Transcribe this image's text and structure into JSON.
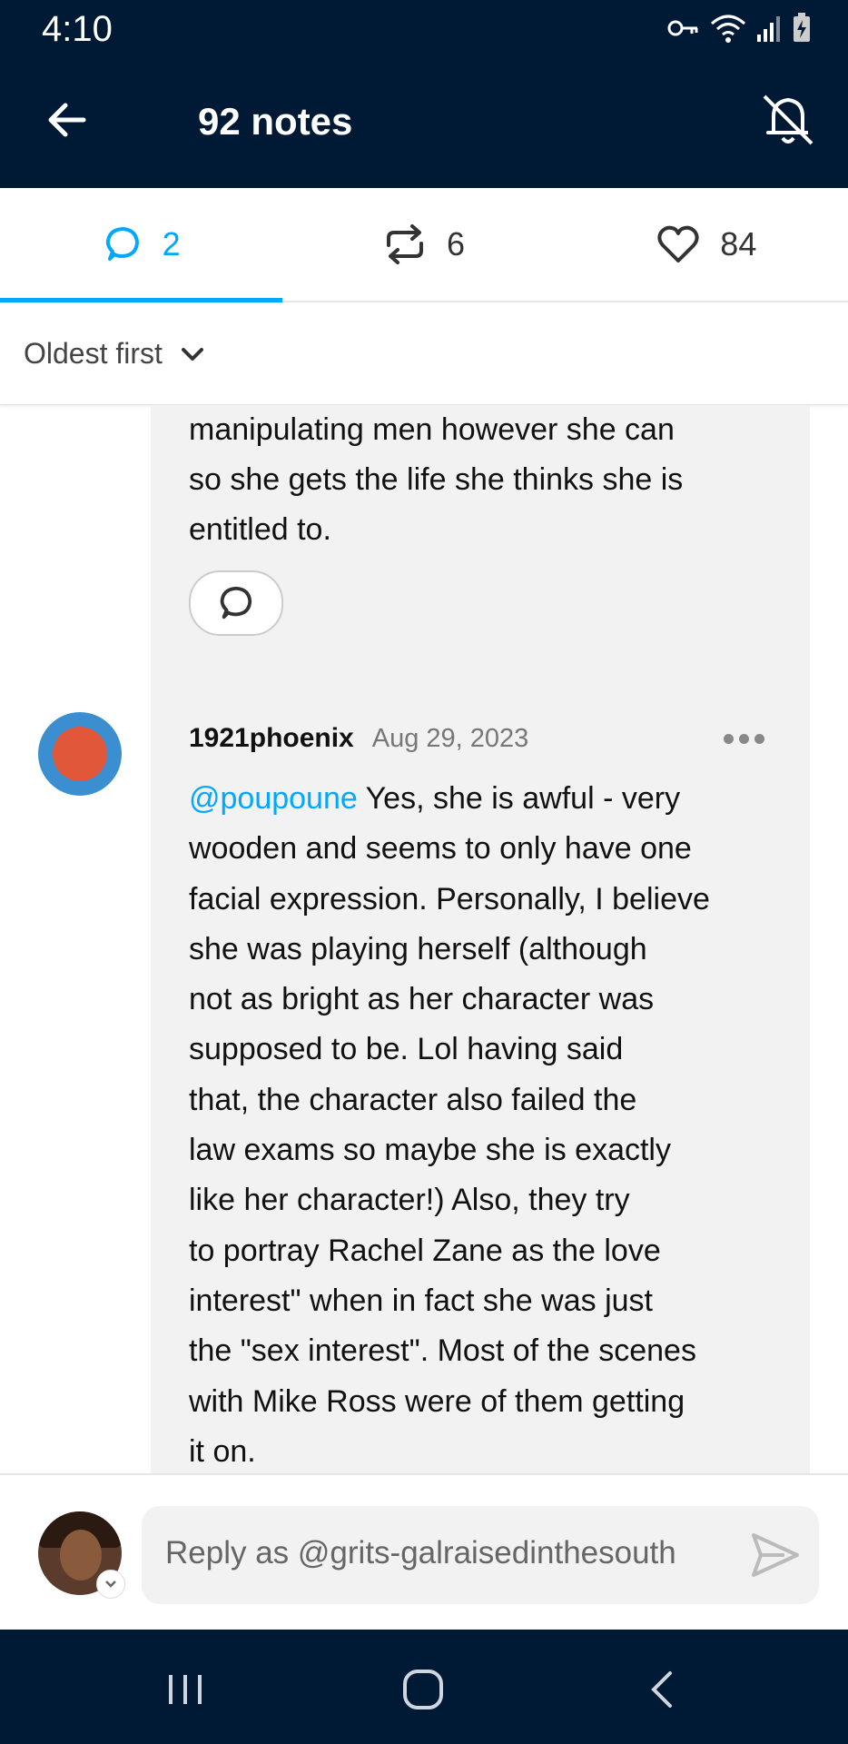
{
  "status_bar": {
    "time": "4:10"
  },
  "app_bar": {
    "title": "92 notes"
  },
  "tabs": [
    {
      "label": "2",
      "icon": "comment-icon",
      "active": true
    },
    {
      "label": "6",
      "icon": "reblog-icon",
      "active": false
    },
    {
      "label": "84",
      "icon": "heart-icon",
      "active": false
    }
  ],
  "sort": {
    "label": "Oldest first"
  },
  "comments": [
    {
      "text_lines": [
        "manipulating men however she can",
        "so she gets the life she thinks she is",
        "entitled to."
      ]
    },
    {
      "username": "1921phoenix",
      "date": "Aug 29, 2023",
      "mention": "@poupoune",
      "text_first_line": " Yes, she is awful - very",
      "text_lines": [
        "wooden and seems to only have one",
        "facial expression.  Personally, I believe",
        "she was playing herself (although",
        "not as bright as her character was",
        "supposed to be. Lol having said",
        "that, the character also failed the",
        "law exams so maybe she is exactly",
        "like her character!)  Also, they try",
        "to portray Rachel Zane as the love",
        "interest\" when in fact she was just",
        "the \"sex interest\".  Most of the scenes",
        "with Mike Ross were of them getting",
        "it on."
      ]
    }
  ],
  "reply": {
    "placeholder": "Reply as @grits-galraisedinthesouth"
  },
  "colors": {
    "header_bg": "#001935",
    "accent": "#00a8ff",
    "card_bg": "#f2f2f2"
  }
}
